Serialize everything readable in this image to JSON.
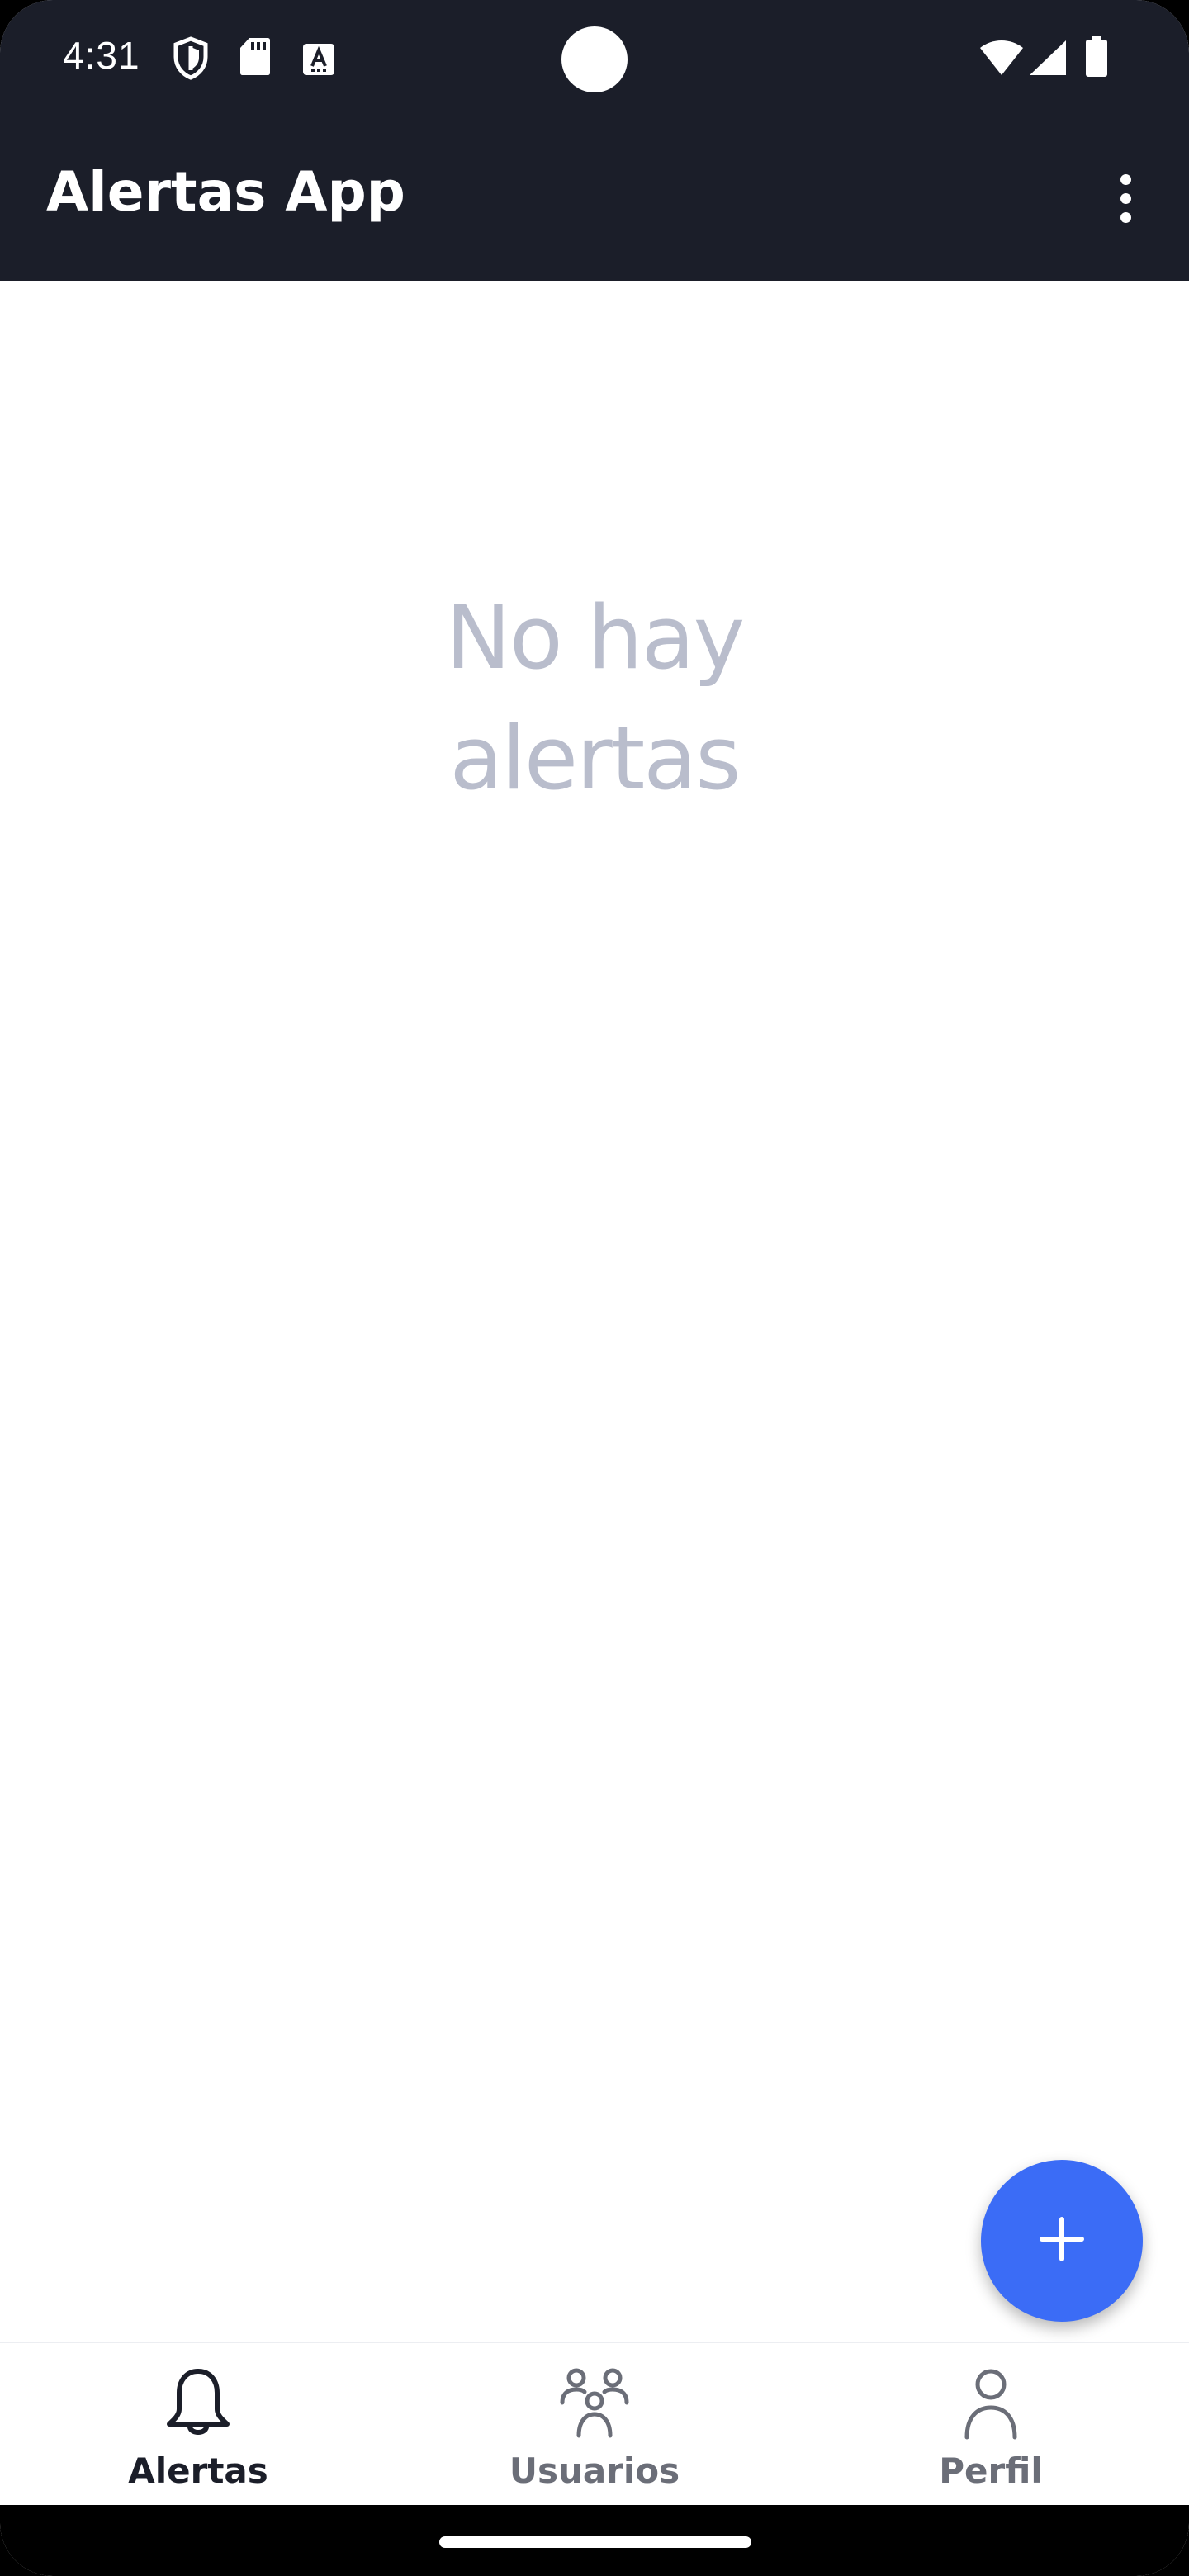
{
  "status_bar": {
    "time": "4:31",
    "icons": [
      "shield-icon",
      "sd-card-icon",
      "keyboard-a-icon",
      "wifi-icon",
      "cell-signal-icon",
      "battery-icon"
    ]
  },
  "app_bar": {
    "title": "Alertas App",
    "menu_icon": "more-vert-icon"
  },
  "main": {
    "empty_message": "No hay alertas"
  },
  "fab": {
    "icon": "plus-icon",
    "color": "#3b6cf6"
  },
  "bottom_nav": {
    "items": [
      {
        "label": "Alertas",
        "icon": "bell-icon",
        "active": true
      },
      {
        "label": "Usuarios",
        "icon": "users-icon",
        "active": false
      },
      {
        "label": "Perfil",
        "icon": "person-icon",
        "active": false
      }
    ]
  },
  "colors": {
    "app_bar": "#1b1e29",
    "empty_text": "#b9bdcc",
    "accent": "#3b6cf6"
  }
}
